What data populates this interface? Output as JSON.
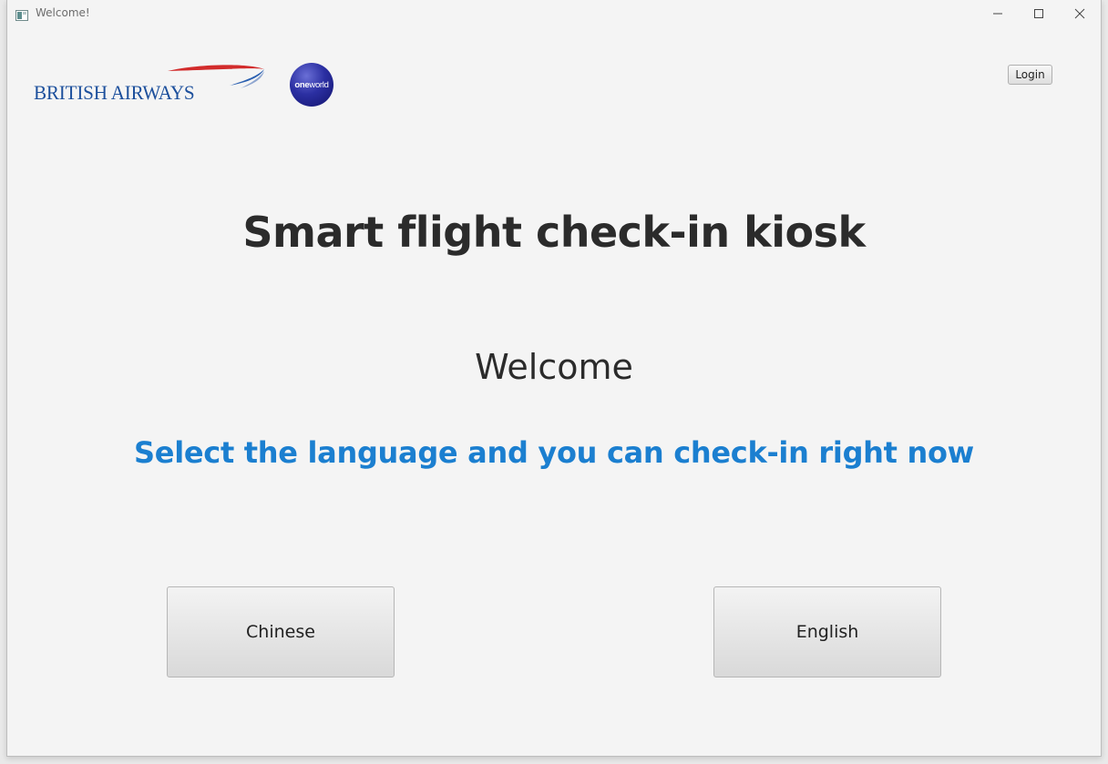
{
  "window": {
    "title": "Welcome!"
  },
  "header": {
    "brand_logo_text": "BRITISH AIRWAYS",
    "alliance_logo_text_bold": "one",
    "alliance_logo_text_regular": "world",
    "login_label": "Login"
  },
  "main": {
    "heading": "Smart flight check-in kiosk",
    "welcome": "Welcome",
    "subtitle": "Select the language and you can check-in right now",
    "languages": [
      {
        "label": "Chinese"
      },
      {
        "label": "English"
      }
    ]
  },
  "colors": {
    "background": "#f4f4f4",
    "heading": "#2b2b2b",
    "subtitle": "#1b7fd0",
    "brand_blue": "#1c4f9c",
    "brand_red": "#d22b2b"
  },
  "icons": {
    "app": "app-icon",
    "minimize": "minimize-icon",
    "maximize": "maximize-icon",
    "close": "close-icon"
  }
}
